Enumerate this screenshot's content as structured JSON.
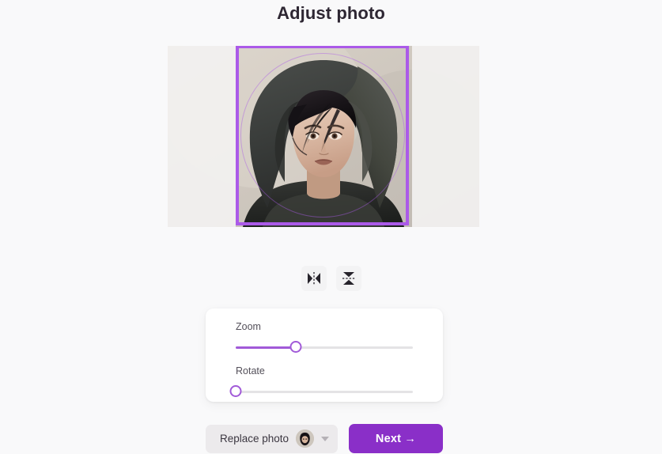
{
  "page": {
    "title": "Adjust photo",
    "background_color": "#f9f9fa"
  },
  "editor": {
    "crop_border_color": "#ab5ae8",
    "crop_shape": "square-with-circle-guide",
    "photo_alt": "portrait of a person wearing a dark hood",
    "dimmed_area_color": "#f2f1f0"
  },
  "transform_tools": [
    {
      "name": "flip-horizontal",
      "icon": "flip-horizontal-icon",
      "label": ""
    },
    {
      "name": "flip-vertical",
      "icon": "flip-vertical-icon",
      "label": ""
    }
  ],
  "sliders": [
    {
      "label": "Zoom",
      "value": 34,
      "min": 0,
      "max": 100,
      "fill_color": "#a15ad8"
    },
    {
      "label": "Rotate",
      "value": 0,
      "min": 0,
      "max": 100,
      "fill_color": "#a15ad8"
    }
  ],
  "footer": {
    "replace_label": "Replace photo",
    "replace_caret_icon": "chevron-down-icon",
    "avatar_icon": "user-avatar-thumbnail",
    "next_label": "Next →",
    "next_color": "#8a2fc8"
  }
}
